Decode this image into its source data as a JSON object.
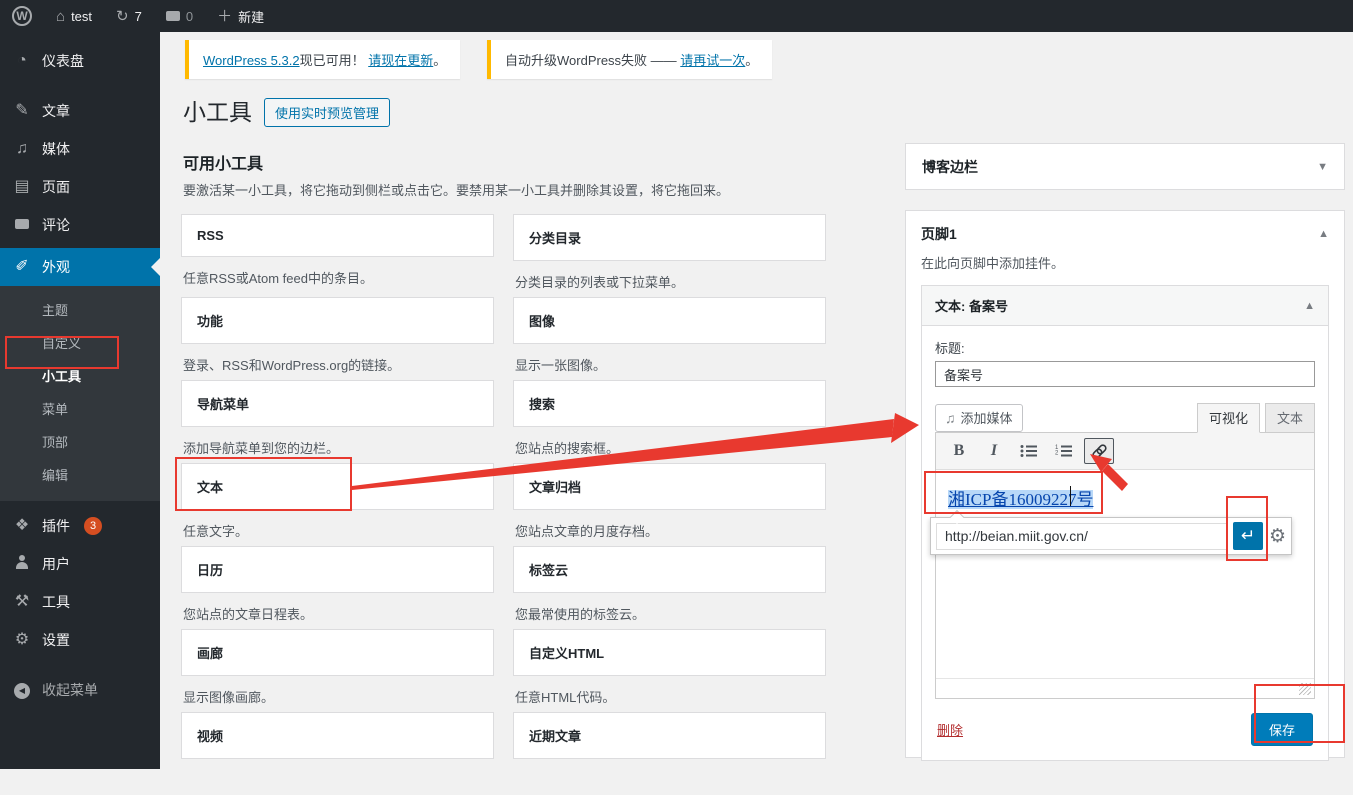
{
  "admin_bar": {
    "logo": "W",
    "site_name": "test",
    "update_count": "7",
    "comment_count": "0",
    "new_label": "新建"
  },
  "sidebar": {
    "items": [
      {
        "label": "仪表盘",
        "glyph": "◔"
      },
      {
        "label": "文章",
        "glyph": "✎"
      },
      {
        "label": "媒体",
        "glyph": "♫"
      },
      {
        "label": "页面",
        "glyph": "▤"
      },
      {
        "label": "评论",
        "glyph": ""
      },
      {
        "label": "外观",
        "glyph": "✐"
      },
      {
        "label": "插件",
        "glyph": "❖",
        "badge": "3"
      },
      {
        "label": "用户",
        "glyph": ""
      },
      {
        "label": "工具",
        "glyph": "⚒"
      },
      {
        "label": "设置",
        "glyph": "⚙"
      }
    ],
    "appearance_submenu": [
      {
        "label": "主题"
      },
      {
        "label": "自定义"
      },
      {
        "label": "小工具",
        "current": true
      },
      {
        "label": "菜单"
      },
      {
        "label": "顶部"
      },
      {
        "label": "编辑"
      }
    ],
    "collapse_label": "收起菜单"
  },
  "notices": [
    {
      "segments": [
        {
          "text": "WordPress 5.3.2"
        },
        {
          "text": "现已可用！ "
        },
        {
          "text": "请现在更新"
        },
        {
          "text": "。"
        }
      ]
    },
    {
      "segments": [
        {
          "text": "自动升级WordPress失败 —— "
        },
        {
          "text": "请再试一次"
        },
        {
          "text": "。"
        }
      ]
    }
  ],
  "page": {
    "title": "小工具",
    "manage_button": "使用实时预览管理"
  },
  "available": {
    "heading": "可用小工具",
    "description": "要激活某一小工具，将它拖动到侧栏或点击它。要禁用某一小工具并删除其设置，将它拖回来。",
    "widgets": [
      {
        "title": "RSS",
        "desc": "任意RSS或Atom feed中的条目。"
      },
      {
        "title": "分类目录",
        "desc": "分类目录的列表或下拉菜单。"
      },
      {
        "title": "功能",
        "desc": "登录、RSS和WordPress.org的链接。"
      },
      {
        "title": "图像",
        "desc": "显示一张图像。"
      },
      {
        "title": "导航菜单",
        "desc": "添加导航菜单到您的边栏。"
      },
      {
        "title": "搜索",
        "desc": "您站点的搜索框。"
      },
      {
        "title": "文本",
        "desc": "任意文字。"
      },
      {
        "title": "文章归档",
        "desc": "您站点文章的月度存档。"
      },
      {
        "title": "日历",
        "desc": "您站点的文章日程表。"
      },
      {
        "title": "标签云",
        "desc": "您最常使用的标签云。"
      },
      {
        "title": "画廊",
        "desc": "显示图像画廊。"
      },
      {
        "title": "自定义HTML",
        "desc": "任意HTML代码。"
      },
      {
        "title": "视频",
        "desc": ""
      },
      {
        "title": "近期文章",
        "desc": ""
      }
    ]
  },
  "panels": {
    "blog_sidebar_title": "博客边栏",
    "footer": {
      "title": "页脚1",
      "description": "在此向页脚中添加挂件。",
      "widget": {
        "header": "文本: 备案号",
        "title_label": "标题:",
        "title_value": "备案号",
        "add_media_label": "添加媒体",
        "tabs": [
          {
            "label": "可视化"
          },
          {
            "label": "文本"
          }
        ],
        "toolbar": {
          "bold": "B",
          "italic": "I"
        },
        "content_link_text": "湘ICP备16009227号",
        "link_url": "http://beian.miit.gov.cn/",
        "delete_label": "删除",
        "save_label": "保存"
      }
    }
  },
  "icons": {
    "home": "⌂",
    "updates": "↻",
    "new_plus": "＋",
    "media": "♫",
    "chevron_down": "▼",
    "chevron_up": "▲",
    "collapse_left": "◀",
    "enter": "↵",
    "gear": "⚙"
  },
  "colors": {
    "accent": "#0073aa",
    "notice_border": "#ffb900",
    "annotation_red": "#e8392f",
    "badge": "#d54e21",
    "editor_link": "#0645ad",
    "selection": "#b8d8f8"
  }
}
